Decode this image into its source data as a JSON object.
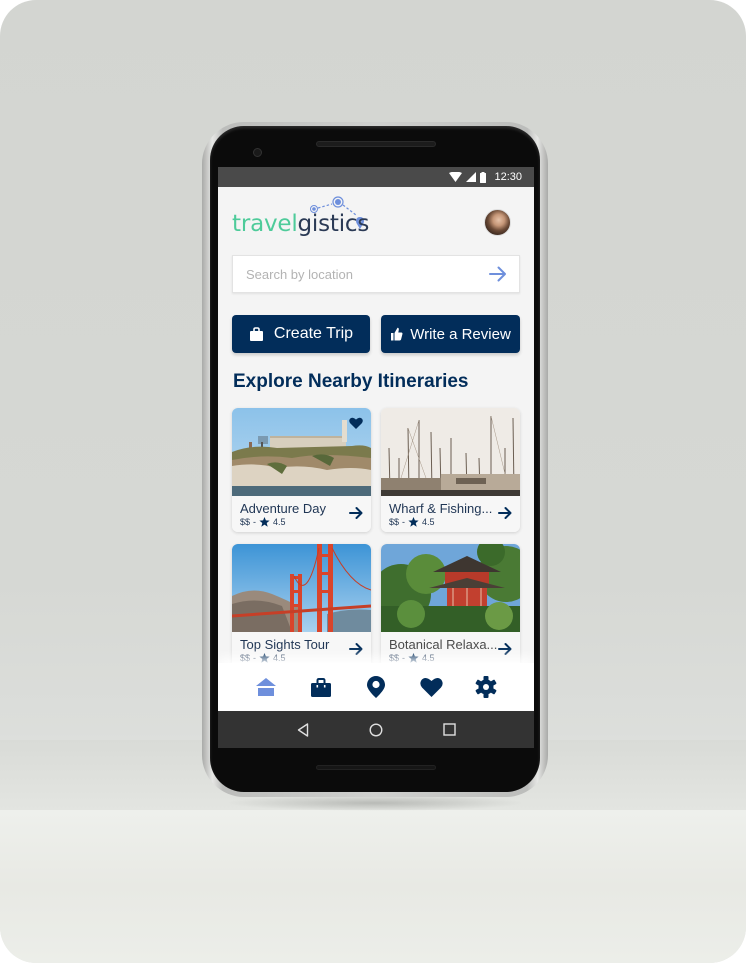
{
  "status_bar": {
    "time": "12:30",
    "icons": [
      "wifi-icon",
      "signal-icon",
      "battery-icon"
    ]
  },
  "header": {
    "logo_part1": "travel",
    "logo_part2": "gistics",
    "avatar": "user-avatar"
  },
  "search": {
    "placeholder": "Search by location",
    "value": "",
    "submit_icon": "arrow-right-icon"
  },
  "actions": {
    "create_trip": {
      "label": "Create Trip",
      "icon": "shopping-bag-icon"
    },
    "write_review": {
      "label": "Write a Review",
      "icon": "thumbs-up-icon"
    }
  },
  "section": {
    "title": "Explore Nearby Itineraries"
  },
  "itineraries": [
    {
      "title": "Adventure Day",
      "price": "$$",
      "separator": "-",
      "rating": "4.5",
      "favorited": true,
      "image": "alcatraz-island"
    },
    {
      "title": "Wharf & Fishing...",
      "price": "$$",
      "separator": "-",
      "rating": "4.5",
      "favorited": false,
      "image": "sailboat-harbor"
    },
    {
      "title": "Top Sights Tour",
      "price": "$$",
      "separator": "-",
      "rating": "4.5",
      "favorited": false,
      "image": "golden-gate-bridge"
    },
    {
      "title": "Botanical Relaxa...",
      "price": "$$",
      "separator": "-",
      "rating": "4.5",
      "favorited": false,
      "image": "japanese-pagoda-garden"
    }
  ],
  "bottom_nav": [
    {
      "name": "home",
      "icon": "home-icon",
      "active": true
    },
    {
      "name": "trips",
      "icon": "briefcase-icon",
      "active": false
    },
    {
      "name": "map",
      "icon": "map-pin-icon",
      "active": false
    },
    {
      "name": "favorites",
      "icon": "heart-icon",
      "active": false
    },
    {
      "name": "settings",
      "icon": "gear-icon",
      "active": false
    }
  ],
  "system_nav": [
    "back",
    "home",
    "recents"
  ],
  "colors": {
    "primary": "#022d5a",
    "accent": "#6e8fdc",
    "logo_green": "#4ecb9a",
    "status_bar": "#4a4a4a",
    "system_nav": "#333333"
  }
}
